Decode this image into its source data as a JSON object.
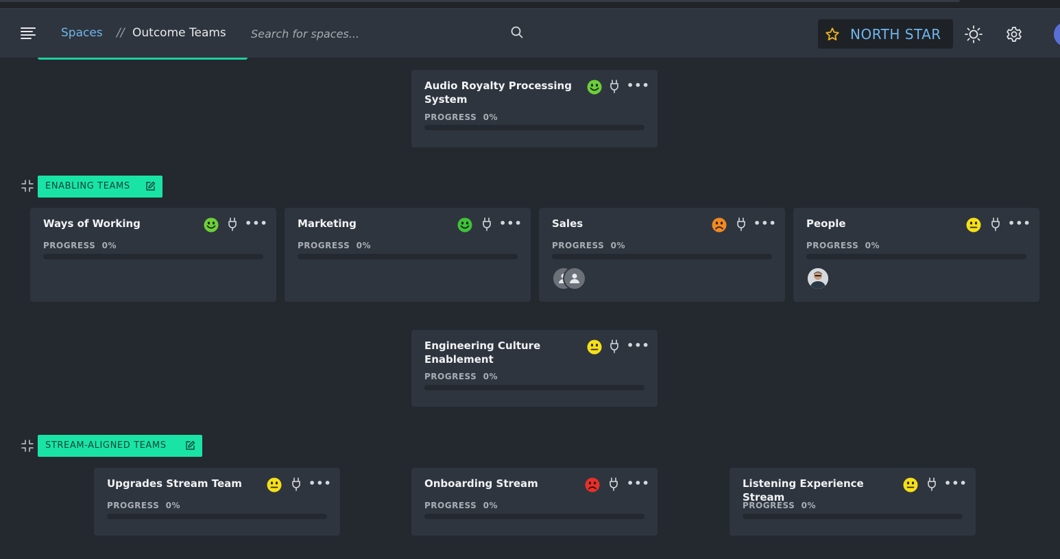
{
  "header": {
    "breadcrumb": {
      "root": "Spaces",
      "separator": "//",
      "current": "Outcome Teams"
    },
    "search": {
      "placeholder": "Search for spaces..."
    },
    "north_star": {
      "label": "NORTH STAR",
      "icon": "star-icon"
    },
    "icons": [
      "menu-icon",
      "search-icon",
      "sun-icon",
      "gear-icon"
    ]
  },
  "colors": {
    "background": "#24282f",
    "header": "#2f353e",
    "card": "#2f353e",
    "accent": "#19e4a6",
    "link": "#6fb6ee",
    "mood_happy": "#6ccf3a",
    "mood_neutral": "#f5df1a",
    "mood_sad": "#f08a24",
    "mood_angry": "#e5312b"
  },
  "top_card": {
    "title": "Audio Royalty Processing System",
    "mood": "happy",
    "progress_label": "PROGRESS",
    "progress_value": "0%",
    "progress": 0
  },
  "enabling": {
    "label": "ENABLING TEAMS",
    "cards": [
      {
        "title": "Ways of Working",
        "mood": "happy",
        "progress_label": "PROGRESS",
        "progress_value": "0%",
        "progress": 0
      },
      {
        "title": "Marketing",
        "mood": "happy",
        "progress_label": "PROGRESS",
        "progress_value": "0%",
        "progress": 0
      },
      {
        "title": "Sales",
        "mood": "sad",
        "progress_label": "PROGRESS",
        "progress_value": "0%",
        "progress": 0
      },
      {
        "title": "People",
        "mood": "neutral",
        "progress_label": "PROGRESS",
        "progress_value": "0%",
        "progress": 0
      }
    ],
    "center_card": {
      "title": "Engineering Culture Enablement",
      "mood": "neutral",
      "progress_label": "PROGRESS",
      "progress_value": "0%",
      "progress": 0
    }
  },
  "stream": {
    "label": "STREAM-ALIGNED TEAMS",
    "cards": [
      {
        "title": "Upgrades Stream Team",
        "mood": "neutral",
        "progress_label": "PROGRESS",
        "progress_value": "0%",
        "progress": 0
      },
      {
        "title": "Onboarding Stream",
        "mood": "angry",
        "progress_label": "PROGRESS",
        "progress_value": "0%",
        "progress": 0
      },
      {
        "title": "Listening Experience Stream",
        "mood": "neutral",
        "progress_label": "PROGRESS",
        "progress_value": "0%",
        "progress": 0
      }
    ]
  }
}
